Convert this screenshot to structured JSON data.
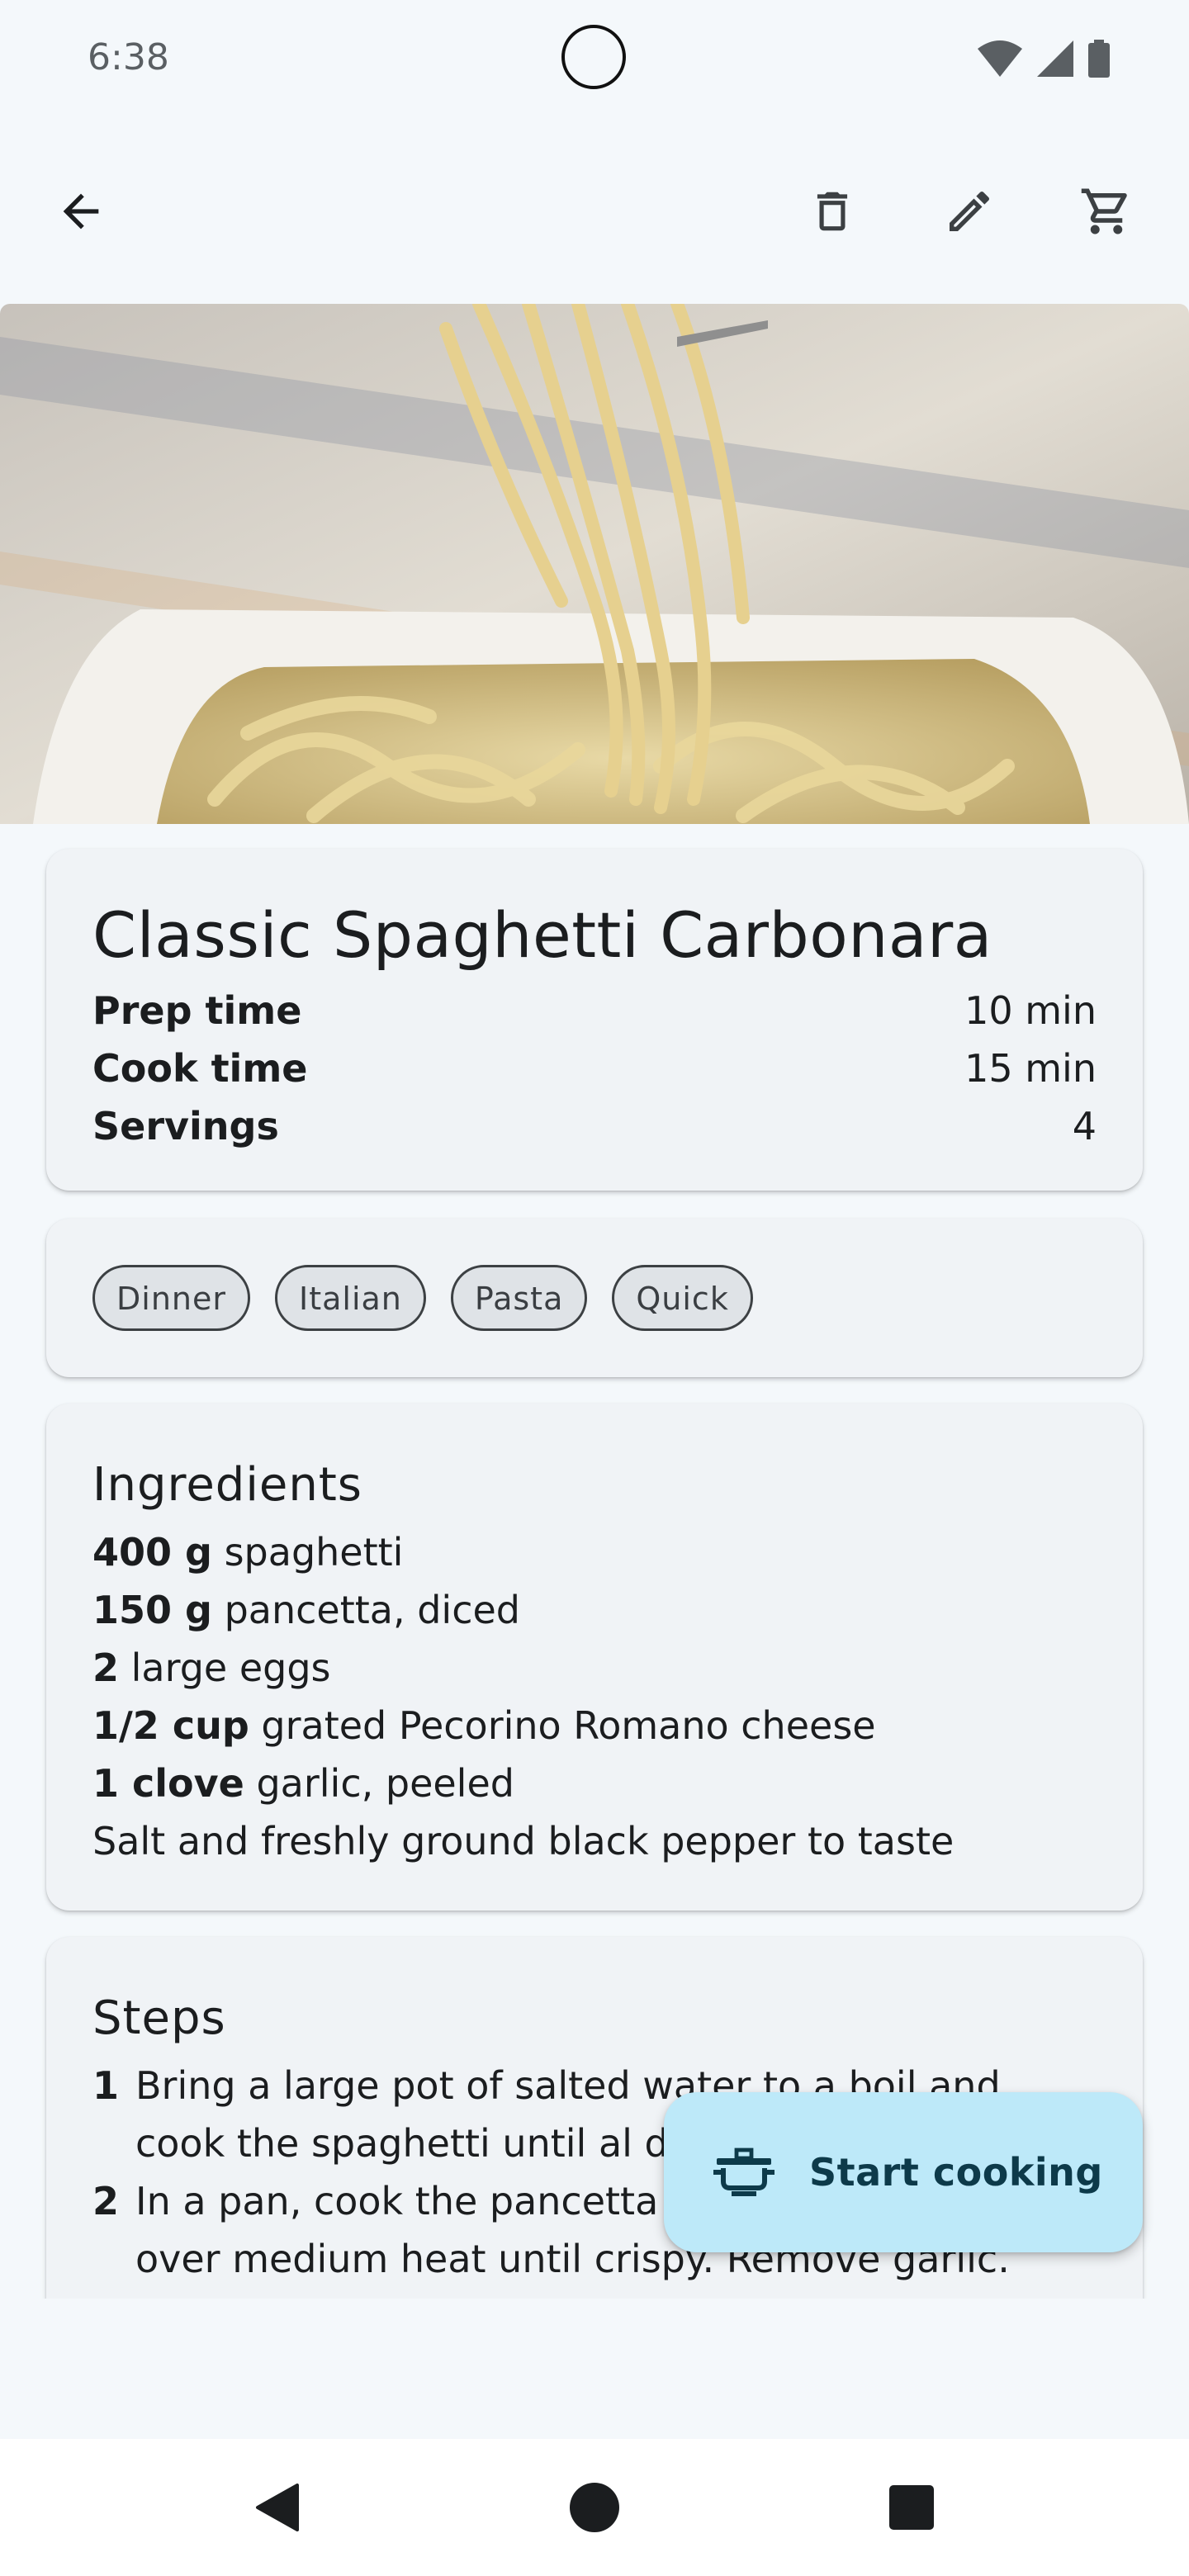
{
  "status": {
    "time": "6:38"
  },
  "toolbar": {
    "back_icon": "arrow-back-icon",
    "delete_icon": "trash-icon",
    "edit_icon": "pencil-icon",
    "cart_icon": "shopping-cart-icon"
  },
  "recipe": {
    "title": "Classic Spaghetti Carbonara",
    "details": [
      {
        "label": "Prep time",
        "value": "10 min"
      },
      {
        "label": "Cook time",
        "value": "15 min"
      },
      {
        "label": "Servings",
        "value": "4"
      }
    ],
    "tags": [
      "Dinner",
      "Italian",
      "Pasta",
      "Quick"
    ]
  },
  "ingredients": {
    "title": "Ingredients",
    "items": [
      {
        "qty": "400 g",
        "text": "spaghetti"
      },
      {
        "qty": "150 g",
        "text": "pancetta, diced"
      },
      {
        "qty": "2",
        "text": "large eggs"
      },
      {
        "qty": "1/2 cup",
        "text": "grated Pecorino Romano cheese"
      },
      {
        "qty": "1 clove",
        "text": "garlic, peeled"
      },
      {
        "qty": "",
        "text": "Salt and freshly ground black pepper to taste"
      }
    ]
  },
  "steps": {
    "title": "Steps",
    "items": [
      {
        "num": "1",
        "text": "Bring a large pot of salted water to a boil and cook the spaghetti until al dente."
      },
      {
        "num": "2",
        "text": "In a pan, cook the pancetta and the garlic clove over medium heat until crispy. Remove garlic."
      }
    ]
  },
  "fab": {
    "label": "Start cooking",
    "icon": "cooking-pot-icon"
  },
  "colors": {
    "background": "#f4f8fb",
    "card": "#f0f3f6",
    "fab": "#bde9f9",
    "chip": "#dfe3e7"
  }
}
